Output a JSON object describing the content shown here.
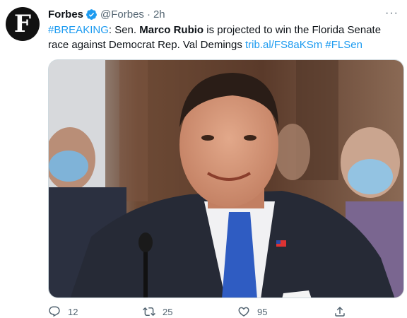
{
  "tweet": {
    "author_name": "Forbes",
    "avatar_letter": "F",
    "handle": "@Forbes",
    "separator": "·",
    "time": "2h",
    "more_label": "···",
    "text": {
      "hashtag_breaking": "#BREAKING",
      "part1": ": Sen. ",
      "name_bold": "Marco Rubio",
      "part2": " is projected to win the Florida Senate race against Democrat Rep. Val Demings ",
      "link": "trib.al/FS8aKSm",
      "space": " ",
      "hashtag_flsen": "#FLSen"
    },
    "media": {
      "icon": "photo-of-marco-rubio"
    },
    "actions": {
      "replies": "12",
      "retweets": "25",
      "likes": "95"
    }
  },
  "colors": {
    "accent": "#1d9bf0",
    "text": "#0f1419",
    "muted": "#536471"
  }
}
